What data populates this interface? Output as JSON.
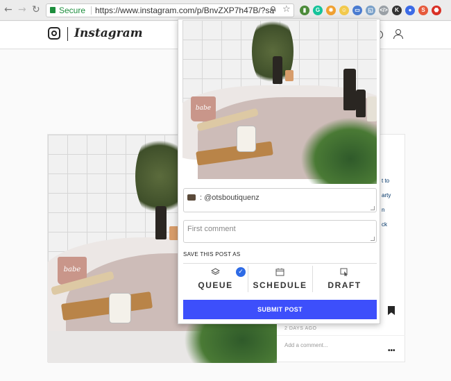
{
  "browser": {
    "back": "←",
    "forward": "→",
    "reload": "↻",
    "secure_label": "Secure",
    "url": "https://www.instagram.com/p/BnvZXP7h47B/?save...",
    "zoom_icon": "⚲",
    "star_icon": "☆",
    "extensions": [
      {
        "name": "chart-extension-icon",
        "color": "#4c8b3a",
        "glyph": "▮"
      },
      {
        "name": "grammarly-extension-icon",
        "color": "#15c39a",
        "glyph": "G"
      },
      {
        "name": "sun-extension-icon",
        "color": "#f0a030",
        "glyph": "✹"
      },
      {
        "name": "emoji-extension-icon",
        "color": "#f2c94c",
        "glyph": "☺"
      },
      {
        "name": "box-extension-icon",
        "color": "#4a7bd0",
        "glyph": "▭"
      },
      {
        "name": "active-extension-icon",
        "color": "#7aa0c8",
        "glyph": "◱"
      },
      {
        "name": "code-extension-icon",
        "color": "#9aa0a6",
        "glyph": "</>"
      },
      {
        "name": "k-extension-icon",
        "color": "#333333",
        "glyph": "K"
      },
      {
        "name": "chat-extension-icon",
        "color": "#3c6be6",
        "glyph": "●"
      },
      {
        "name": "s-extension-icon",
        "color": "#e65a3c",
        "glyph": "S"
      },
      {
        "name": "red-extension-icon",
        "color": "#d93025",
        "glyph": "⬣"
      }
    ]
  },
  "instagram": {
    "wordmark": "Instagram",
    "sidebar_text": [
      "t to",
      "arty",
      "n",
      "ck",
      "n"
    ],
    "post_time": "2 DAYS AGO",
    "add_comment_placeholder": "Add a comment...",
    "more_icon": "•••"
  },
  "popup": {
    "caption_prefix": ": @otsboutiquenz",
    "first_comment_placeholder": "First comment",
    "save_as_label": "SAVE THIS POST AS",
    "options": [
      {
        "label": "QUEUE",
        "selected": true
      },
      {
        "label": "SCHEDULE",
        "selected": false
      },
      {
        "label": "DRAFT",
        "selected": false
      }
    ],
    "check_glyph": "✓",
    "submit_label": "SUBMIT POST",
    "accent_color": "#3d4ffb"
  },
  "photo": {
    "mug_text": "babe"
  }
}
